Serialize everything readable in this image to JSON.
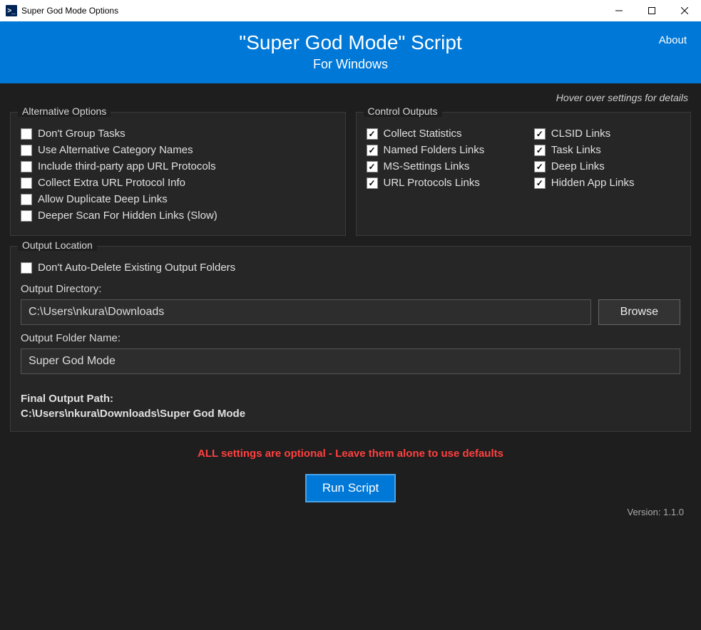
{
  "window": {
    "title": "Super God Mode Options"
  },
  "header": {
    "title": "\"Super God Mode\" Script",
    "subtitle": "For Windows",
    "about": "About"
  },
  "hint": "Hover over settings for details",
  "groups": {
    "alternative": {
      "legend": "Alternative Options",
      "items": [
        {
          "label": "Don't Group Tasks",
          "checked": false
        },
        {
          "label": "Use Alternative Category Names",
          "checked": false
        },
        {
          "label": "Include third-party app URL Protocols",
          "checked": false
        },
        {
          "label": "Collect Extra URL Protocol Info",
          "checked": false
        },
        {
          "label": "Allow Duplicate Deep Links",
          "checked": false
        },
        {
          "label": "Deeper Scan For Hidden Links (Slow)",
          "checked": false
        }
      ]
    },
    "control": {
      "legend": "Control Outputs",
      "col1": [
        {
          "label": "Collect Statistics",
          "checked": true
        },
        {
          "label": "Named Folders Links",
          "checked": true
        },
        {
          "label": "MS-Settings Links",
          "checked": true
        },
        {
          "label": "URL Protocols Links",
          "checked": true
        }
      ],
      "col2": [
        {
          "label": "CLSID Links",
          "checked": true
        },
        {
          "label": "Task Links",
          "checked": true
        },
        {
          "label": "Deep Links",
          "checked": true
        },
        {
          "label": "Hidden App Links",
          "checked": true
        }
      ]
    },
    "output": {
      "legend": "Output Location",
      "noDelete": {
        "label": "Don't Auto-Delete Existing Output Folders",
        "checked": false
      },
      "dirLabel": "Output Directory:",
      "dirValue": "C:\\Users\\nkura\\Downloads",
      "browse": "Browse",
      "folderLabel": "Output Folder Name:",
      "folderValue": "Super God Mode",
      "finalLabel": "Final Output Path:",
      "finalValue": "C:\\Users\\nkura\\Downloads\\Super God Mode"
    }
  },
  "warn": "ALL settings are optional - Leave them alone to use defaults",
  "runLabel": "Run Script",
  "version": "Version: 1.1.0"
}
